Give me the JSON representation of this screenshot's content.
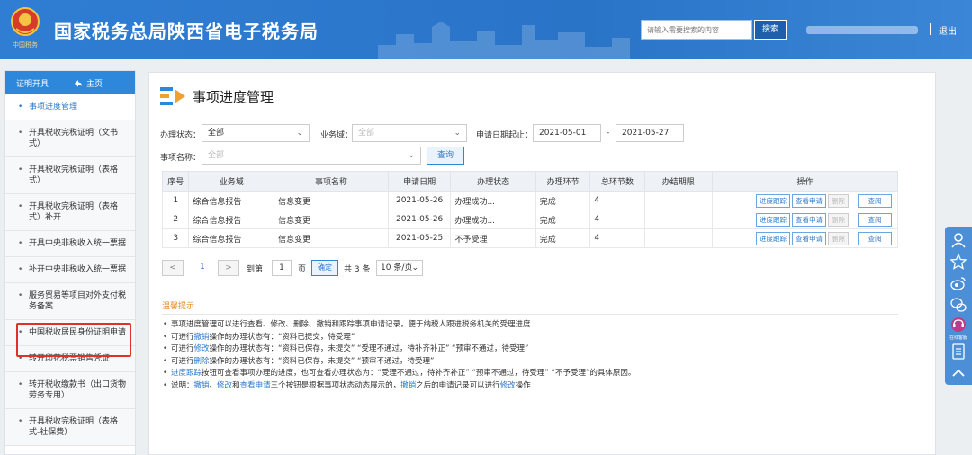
{
  "header": {
    "site_title": "国家税务总局陕西省电子税务局",
    "search_placeholder": "请输入需要搜索的内容",
    "search_button": "搜索",
    "logout": "退出",
    "emblem_caption": "中国税务"
  },
  "sidebar": {
    "title": "证明开具",
    "home": "主页",
    "items": [
      {
        "label": "事项进度管理",
        "active": true
      },
      {
        "label": "开具税收完税证明（文书式）",
        "active": false
      },
      {
        "label": "开具税收完税证明（表格式）",
        "active": false
      },
      {
        "label": "开具税收完税证明（表格式）补开",
        "active": false
      },
      {
        "label": "开具中央非税收入统一票据",
        "active": false
      },
      {
        "label": "补开中央非税收入统一票据",
        "active": false
      },
      {
        "label": "服务贸易等项目对外支付税务备案",
        "active": false
      },
      {
        "label": "中国税收居民身份证明申请",
        "active": false
      },
      {
        "label": "转开印花税票销售凭证",
        "active": false
      },
      {
        "label": "转开税收缴款书（出口货物劳务专用）",
        "active": false
      },
      {
        "label": "开具税收完税证明（表格式-社保费）",
        "active": false
      }
    ]
  },
  "main": {
    "page_title": "事项进度管理",
    "filters": {
      "status_label": "办理状态：",
      "status_value": "全部",
      "domain_label": "业务域：",
      "domain_value": "全部",
      "date_label": "申请日期起止：",
      "date_start": "2021-05-01",
      "date_sep": "-",
      "date_end": "2021-05-27",
      "name_label": "事项名称：",
      "name_value": "全部",
      "query_button": "查询"
    },
    "table": {
      "headers": [
        "序号",
        "业务域",
        "事项名称",
        "申请日期",
        "办理状态",
        "办理环节",
        "总环节数",
        "办结期限",
        "操作"
      ],
      "rows": [
        {
          "no": "1",
          "domain": "综合信息报告",
          "name": "信息变更",
          "date": "2021-05-26",
          "status": "办理成功...",
          "stage": "完成",
          "total": "4",
          "deadline": ""
        },
        {
          "no": "2",
          "domain": "综合信息报告",
          "name": "信息变更",
          "date": "2021-05-26",
          "status": "办理成功...",
          "stage": "完成",
          "total": "4",
          "deadline": ""
        },
        {
          "no": "3",
          "domain": "综合信息报告",
          "name": "信息变更",
          "date": "2021-05-25",
          "status": "不予受理",
          "stage": "完成",
          "total": "4",
          "deadline": ""
        }
      ],
      "op_labels": {
        "track": "进度跟踪",
        "view_apply": "查看申请",
        "delete": "删除",
        "view": "查阅"
      }
    },
    "pagination": {
      "prev": "<",
      "current": "1",
      "next": ">",
      "goto": "到第",
      "page_input": "1",
      "page_unit": "页",
      "confirm": "确定",
      "total": "共 3 条",
      "page_size": "10 条/页"
    },
    "tips": {
      "title": "温馨提示",
      "line1": "事项进度管理可以进行查看、修改、删除、撤销和跟踪事项申请记录，便于纳税人跟进税务机关的受理进度",
      "line2_pre": "可进行",
      "line2_kw": "撤销",
      "line2_post": "操作的办理状态有：“资料已提交，待受理”",
      "line3_pre": "可进行",
      "line3_kw": "修改",
      "line3_post": "操作的办理状态有：“资料已保存，未提交”  “受理不通过，待补齐补正”  “预审不通过，待受理”",
      "line4_pre": "可进行",
      "line4_kw": "删除",
      "line4_post": "操作的办理状态有：“资料已保存，未提交”  “预审不通过，待受理”",
      "line5_kw": "进度跟踪",
      "line5_post": "按钮可查看事项办理的进度，也可查看办理状态为：“受理不通过，待补齐补正”  “预审不通过，待受理”  “不予受理”的具体原因。",
      "line6_pre": "说明：",
      "line6_kw1": "撤销",
      "line6_sep1": "、",
      "line6_kw2": "修改",
      "line6_mid": "和",
      "line6_kw3": "查看申请",
      "line6_mid2": "三个按钮是根据事项状态动态展示的，",
      "line6_kw4": "撤销",
      "line6_mid3": "之后的申请记录可以进行",
      "line6_kw5": "修改",
      "line6_end": "操作"
    }
  },
  "float_bar": {
    "icons": [
      "user-icon",
      "star-icon",
      "weibo-icon",
      "wechat-icon",
      "online-service-icon",
      "document-icon",
      "chevron-up-icon"
    ],
    "service_label": "在线客服"
  },
  "colors": {
    "header_blue": "#2f7ed4",
    "accent_blue": "#2d78c9",
    "tips_orange": "#e58a1f",
    "highlight_red": "#e0302b"
  }
}
